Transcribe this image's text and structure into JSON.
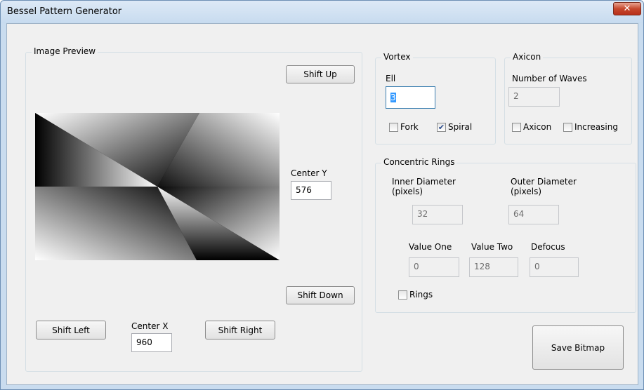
{
  "window": {
    "title": "Bessel Pattern Generator",
    "close_symbol": "✕"
  },
  "image_preview": {
    "title": "Image Preview",
    "shift_up": "Shift Up",
    "shift_down": "Shift Down",
    "shift_left": "Shift Left",
    "shift_right": "Shift Right",
    "center_y_label": "Center Y",
    "center_y_value": "576",
    "center_x_label": "Center X",
    "center_x_value": "960"
  },
  "vortex": {
    "title": "Vortex",
    "ell_label": "Ell",
    "ell_value": "3",
    "fork_label": "Fork",
    "fork_checked": false,
    "spiral_label": "Spiral",
    "spiral_checked": true
  },
  "axicon": {
    "title": "Axicon",
    "waves_label": "Number of Waves",
    "waves_value": "2",
    "axicon_label": "Axicon",
    "axicon_checked": false,
    "increasing_label": "Increasing",
    "increasing_checked": false
  },
  "rings": {
    "title": "Concentric Rings",
    "inner_label_1": "Inner Diameter",
    "inner_label_2": "(pixels)",
    "inner_value": "32",
    "outer_label_1": "Outer Diameter",
    "outer_label_2": "(pixels)",
    "outer_value": "64",
    "value_one_label": "Value One",
    "value_one": "0",
    "value_two_label": "Value Two",
    "value_two": "128",
    "defocus_label": "Defocus",
    "defocus": "0",
    "rings_label": "Rings",
    "rings_checked": false
  },
  "save_bitmap": "Save Bitmap"
}
